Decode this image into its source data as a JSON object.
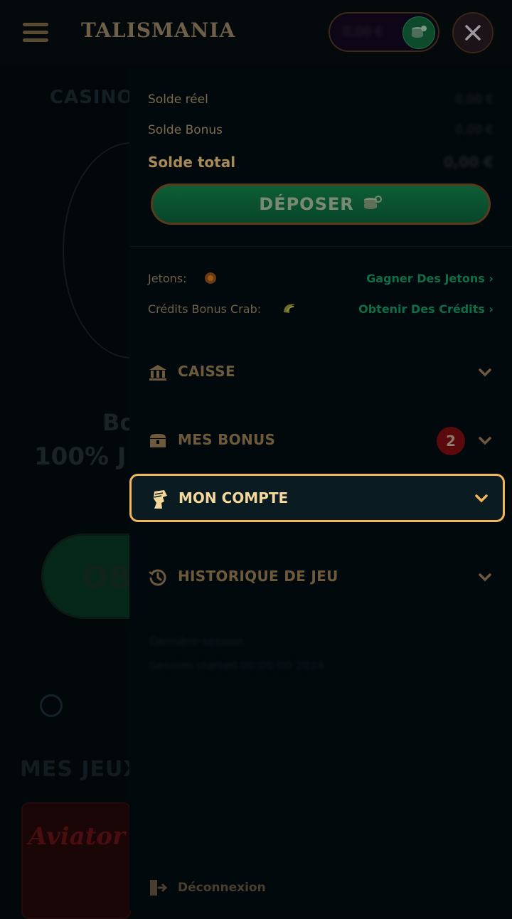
{
  "header": {
    "logo": "TALISMANIA",
    "balance": "0,00 €"
  },
  "background": {
    "casino_label": "CASINO",
    "bonus_line1": "Bo",
    "bonus_line2": "100% J",
    "obtain_button": "OB",
    "section_title": "MES JEUX",
    "game_card": "Aviator"
  },
  "drawer": {
    "balances": {
      "real_label": "Solde réel",
      "real_value": "0,00 €",
      "bonus_label": "Solde Bonus",
      "bonus_value": "0,00 €",
      "total_label": "Solde total",
      "total_value": "0,00 €"
    },
    "deposit_button": "DÉPOSER",
    "tokens": {
      "jetons_label": "Jetons:",
      "jetons_link": "Gagner Des Jetons",
      "credits_label": "Crédits Bonus Crab:",
      "credits_link": "Obtenir Des Crédits"
    },
    "menu": {
      "caisse": "CAISSE",
      "mes_bonus": "MES BONUS",
      "mes_bonus_badge": "2",
      "mon_compte": "MON COMPTE",
      "historique": "HISTORIQUE DE JEU"
    },
    "session": {
      "line1": "Dernière session",
      "line2": "Session started 00:00:00 2024"
    },
    "logout": "Déconnexion"
  },
  "colors": {
    "highlight_border": "#f4b45a",
    "highlight_text": "#f4d79a",
    "link_green": "#0f6e48",
    "badge_red": "#5a0a0c"
  }
}
